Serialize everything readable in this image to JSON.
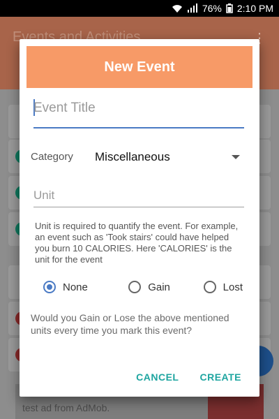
{
  "status_bar": {
    "battery": "76%",
    "time": "2:10 PM",
    "icons": [
      "wifi-icon",
      "signal-icon",
      "battery-icon"
    ]
  },
  "background": {
    "app_title": "Events and Activities",
    "ad_text": "test ad from AdMob."
  },
  "dialog": {
    "title": "New Event",
    "event_title_placeholder": "Event Title",
    "category_label": "Category",
    "category_value": "Miscellaneous",
    "unit_placeholder": "Unit",
    "help_text": "Unit is required to quantify the event. For example, an event such as 'Took stairs' could have helped you burn 10 CALORIES. Here 'CALORIES' is the unit for the event",
    "radio_options": [
      {
        "label": "None",
        "checked": true
      },
      {
        "label": "Gain",
        "checked": false
      },
      {
        "label": "Lost",
        "checked": false
      }
    ],
    "question": "Would you Gain or Lose the above mentioned units every time you mark this event?",
    "cancel_label": "CANCEL",
    "create_label": "CREATE"
  },
  "colors": {
    "header": "#f79a67",
    "accent": "#4a7ac4",
    "action": "#1ea5a0"
  }
}
